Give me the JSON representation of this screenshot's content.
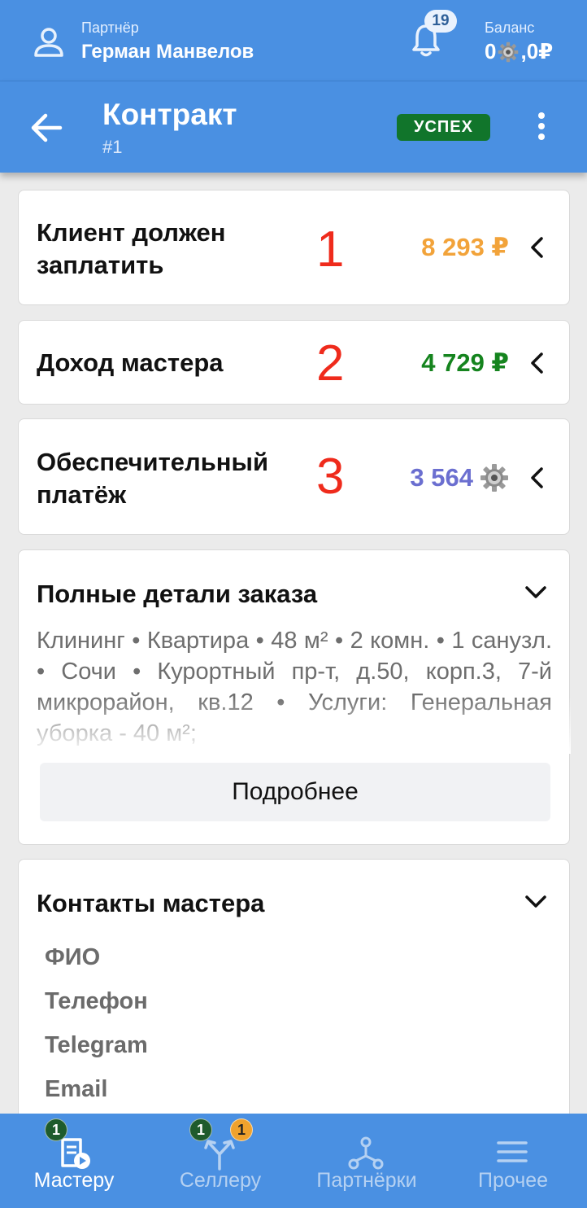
{
  "topbar": {
    "partner_label": "Партнёр",
    "partner_name": "Герман Манвелов",
    "notifications_count": "19",
    "balance_label": "Баланс",
    "balance_left": "0",
    "balance_right": ",0₽",
    "icons": [
      "user-icon",
      "bell-icon",
      "gear-coin-icon"
    ]
  },
  "header": {
    "title": "Контракт",
    "subtitle": "#1",
    "status": "УСПЕХ",
    "status_color": "#11752b"
  },
  "rows": [
    {
      "label_line1": "Клиент должен",
      "label_line2": "заплатить",
      "number": "1",
      "amount": "8 293 ₽",
      "amount_color": "#f2a33a"
    },
    {
      "label_line1": "Доход мастера",
      "label_line2": "",
      "number": "2",
      "amount": "4 729 ₽",
      "amount_color": "#15841e"
    },
    {
      "label_line1": "Обеспечительный",
      "label_line2": "платёж",
      "number": "3",
      "amount": "3 564",
      "amount_color": "#6b6fd0"
    }
  ],
  "details": {
    "title": "Полные детали заказа",
    "text": "Клининг • Квартира • 48 м² • 2 комн. • 1 санузл. • Сочи • Курортный пр-т, д.50, корп.3, 7-й микрорайон, кв.12 • Услуги: Генеральная уборка - 40 м²;",
    "more_button": "Подробнее"
  },
  "contacts": {
    "title": "Контакты мастера",
    "labels": [
      "ФИО",
      "Телефон",
      "Telegram",
      "Email"
    ]
  },
  "tabbar": {
    "tabs": [
      {
        "label": "Мастеру",
        "badge_green": "1",
        "icon": "document-play-icon"
      },
      {
        "label": "Селлеру",
        "badge_green": "1",
        "badge_orange": "1",
        "icon": "fork-arrows-icon"
      },
      {
        "label": "Партнёрки",
        "icon": "network-nodes-icon"
      },
      {
        "label": "Прочее",
        "icon": "hamburger-icon"
      }
    ]
  },
  "colors": {
    "brand": "#4a90e2",
    "number_red": "#ef2b1c"
  }
}
